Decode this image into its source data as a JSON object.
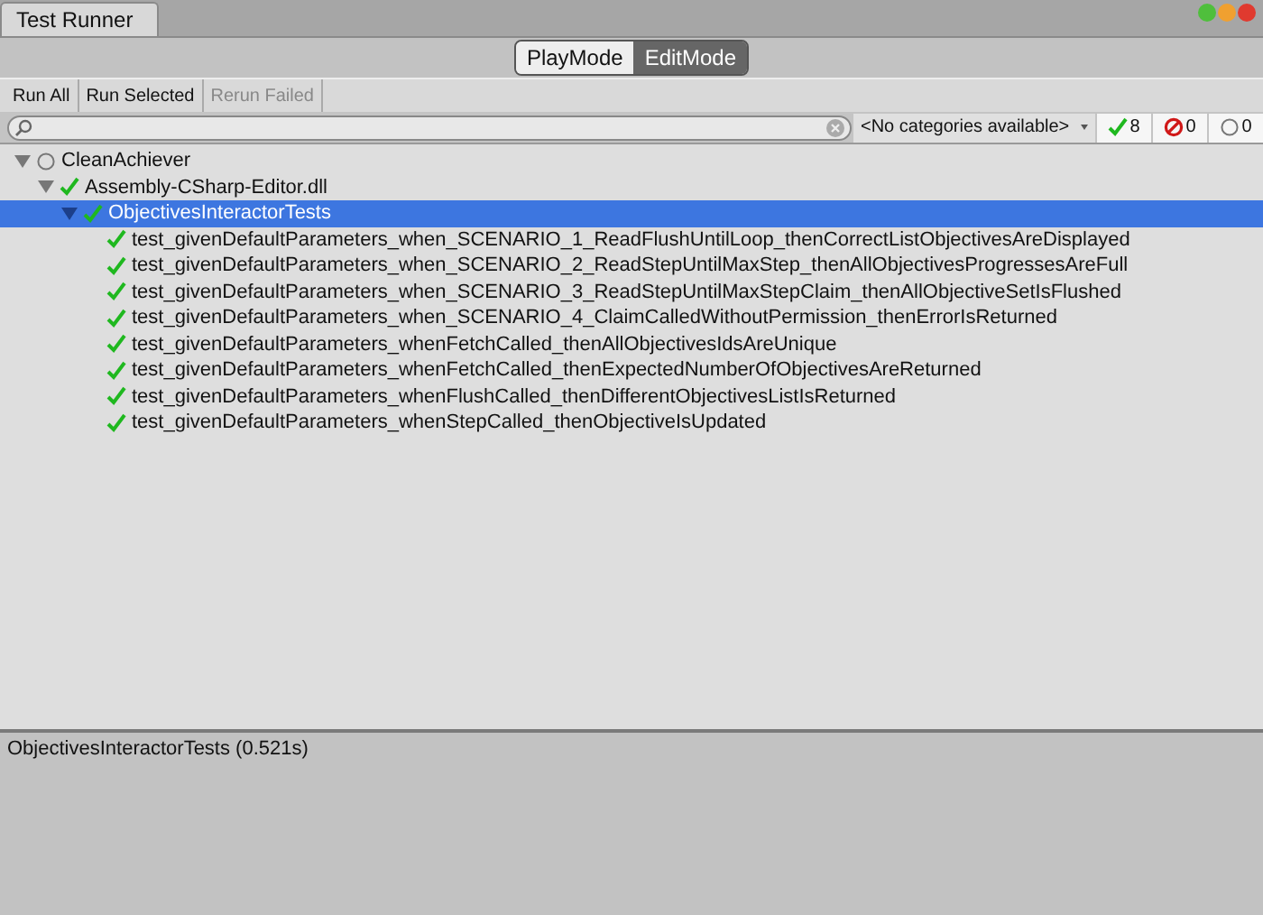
{
  "window": {
    "title": "Test Runner"
  },
  "mode_tabs": [
    {
      "label": "PlayMode",
      "selected": false
    },
    {
      "label": "EditMode",
      "selected": true
    }
  ],
  "toolbar": [
    {
      "label": "Run All",
      "disabled": false
    },
    {
      "label": "Run Selected",
      "disabled": false
    },
    {
      "label": "Rerun Failed",
      "disabled": true
    }
  ],
  "category_dropdown": "<No categories available>",
  "filters": [
    {
      "kind": "passed",
      "count": "8"
    },
    {
      "kind": "failed",
      "count": "0"
    },
    {
      "kind": "notrun",
      "count": "0"
    }
  ],
  "tree": [
    {
      "label": "CleanAchiever",
      "kind": "notrun",
      "expanded": true,
      "selected": false,
      "children": [
        {
          "label": "Assembly-CSharp-Editor.dll",
          "kind": "passed",
          "expanded": true,
          "selected": false,
          "children": [
            {
              "label": "ObjectivesInteractorTests",
              "kind": "passed",
              "expanded": true,
              "selected": true,
              "children": [
                {
                  "label": "test_givenDefaultParameters_when_SCENARIO_1_ReadFlushUntilLoop_thenCorrectListObjectivesAreDisplayed",
                  "kind": "passed",
                  "selected": false
                },
                {
                  "label": "test_givenDefaultParameters_when_SCENARIO_2_ReadStepUntilMaxStep_thenAllObjectivesProgressesAreFull",
                  "kind": "passed",
                  "selected": false
                },
                {
                  "label": "test_givenDefaultParameters_when_SCENARIO_3_ReadStepUntilMaxStepClaim_thenAllObjectiveSetIsFlushed",
                  "kind": "passed",
                  "selected": false
                },
                {
                  "label": "test_givenDefaultParameters_when_SCENARIO_4_ClaimCalledWithoutPermission_thenErrorIsReturned",
                  "kind": "passed",
                  "selected": false
                },
                {
                  "label": "test_givenDefaultParameters_whenFetchCalled_thenAllObjectivesIdsAreUnique",
                  "kind": "passed",
                  "selected": false
                },
                {
                  "label": "test_givenDefaultParameters_whenFetchCalled_thenExpectedNumberOfObjectivesAreReturned",
                  "kind": "passed",
                  "selected": false
                },
                {
                  "label": "test_givenDefaultParameters_whenFlushCalled_thenDifferentObjectivesListIsReturned",
                  "kind": "passed",
                  "selected": false
                },
                {
                  "label": "test_givenDefaultParameters_whenStepCalled_thenObjectiveIsUpdated",
                  "kind": "passed",
                  "selected": false
                }
              ]
            }
          ]
        }
      ]
    }
  ],
  "details": "ObjectivesInteractorTests (0.521s)"
}
